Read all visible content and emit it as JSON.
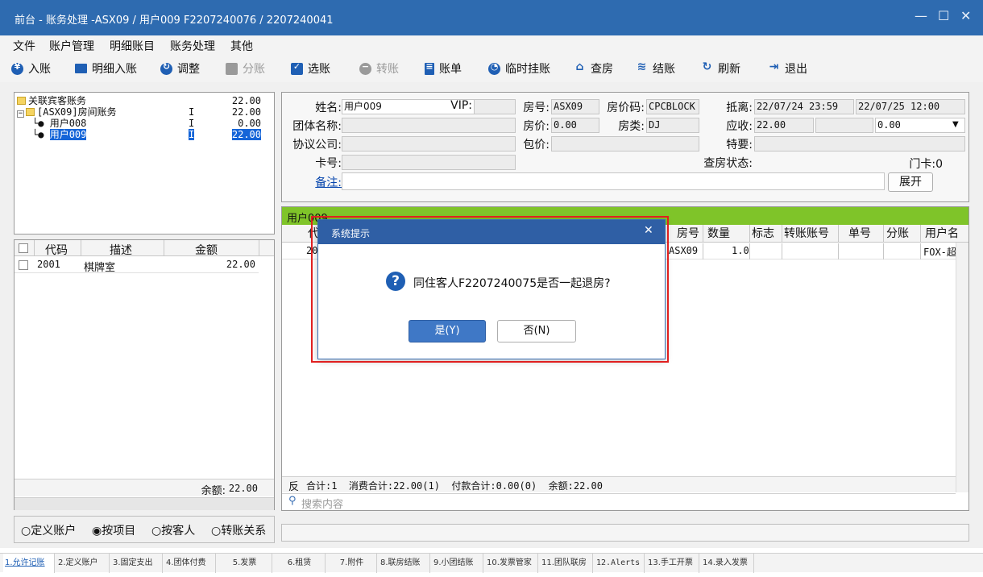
{
  "window": {
    "title": "前台 - 账务处理 -ASX09 / 用户009 F2207240076 / 2207240041",
    "minimize": "—",
    "maximize": "☐",
    "close": "✕"
  },
  "menu": [
    "文件",
    "账户管理",
    "明细账目",
    "账务处理",
    "其他"
  ],
  "toolbar": [
    {
      "label": "入账",
      "icon": "yen-coin-icon",
      "disabled": false
    },
    {
      "label": "明细入账",
      "icon": "monitor-icon",
      "disabled": false
    },
    {
      "label": "调整",
      "icon": "adjust-icon",
      "disabled": false
    },
    {
      "label": "分账",
      "icon": "split-icon",
      "disabled": true
    },
    {
      "label": "选账",
      "icon": "select-icon",
      "disabled": false
    },
    {
      "label": "转账",
      "icon": "transfer-icon",
      "disabled": true
    },
    {
      "label": "账单",
      "icon": "bill-icon",
      "disabled": false
    },
    {
      "label": "临时挂账",
      "icon": "clock-icon",
      "disabled": false
    },
    {
      "label": "查房",
      "icon": "house-icon",
      "disabled": false
    },
    {
      "label": "结账",
      "icon": "database-icon",
      "disabled": false
    },
    {
      "label": "刷新",
      "icon": "refresh-icon",
      "disabled": false
    },
    {
      "label": "退出",
      "icon": "exit-icon",
      "disabled": false
    }
  ],
  "tree": [
    {
      "label": "关联宾客账务",
      "flag": "",
      "amount": "22.00"
    },
    {
      "label": "[ASX09]房间账务",
      "flag": "I",
      "amount": "22.00"
    },
    {
      "label": "用户008",
      "flag": "I",
      "amount": "0.00"
    },
    {
      "label": "用户009",
      "flag": "I",
      "amount": "22.00"
    }
  ],
  "items_table": {
    "headers": [
      "代码",
      "描述",
      "金额"
    ],
    "rows": [
      {
        "code": "2001",
        "desc": "棋牌室",
        "amount": "22.00"
      }
    ],
    "balance_label": "余额:",
    "balance_value": "22.00"
  },
  "view_modes": [
    {
      "label": "定义账户",
      "checked": false
    },
    {
      "label": "按项目",
      "checked": true
    },
    {
      "label": "按客人",
      "checked": false
    },
    {
      "label": "转账关系",
      "checked": false
    }
  ],
  "guest": {
    "name_label": "姓名:",
    "name": "用户009",
    "vip_label": "VIP:",
    "vip": "",
    "room_label": "房号:",
    "room": "ASX09",
    "rate_code_label": "房价码:",
    "rate_code": "CPCBLOCK",
    "arrival_label": "抵离:",
    "arrival": "22/07/24 23:59",
    "departure": "22/07/25 12:00",
    "group_label": "团体名称:",
    "group": "",
    "price_label": "房价:",
    "price": "0.00",
    "room_type_label": "房类:",
    "room_type": "DJ",
    "receivable_label": "应收:",
    "receivable": "22.00",
    "receivable2": "0.00",
    "agreement_label": "协议公司:",
    "agreement": "",
    "package_label": "包价:",
    "package": "",
    "special_label": "特要:",
    "special": "",
    "card_label": "卡号:",
    "card": "",
    "inspect_label": "查房状态:",
    "inspect": "",
    "door_card": "门卡:0",
    "remark_label": "备注:",
    "remark": "",
    "expand_button": "展开"
  },
  "detail": {
    "header": "用户009",
    "columns": [
      "代",
      "房号",
      "数量",
      "标志",
      "转账账号",
      "单号",
      "分账",
      "用户名"
    ],
    "row": {
      "code": "20",
      "room": "ASX09",
      "qty": "1.0",
      "user": "FOX-超"
    },
    "summary_prefix": "反",
    "summary": "合计:1  消费合计:22.00(1)  付款合计:0.00(0)  余额:22.00",
    "search_placeholder": "搜索内容"
  },
  "dialog": {
    "title": "系统提示",
    "message": "同住客人F2207240075是否一起退房?",
    "yes": "是(Y)",
    "no": "否(N)",
    "close": "✕"
  },
  "status_tabs": [
    "1.允许记账",
    "2.定义账户",
    "3.固定支出",
    "4.团体付费",
    "5.发票",
    "6.租赁",
    "7.附件",
    "8.联房结账",
    "9.小团结账",
    "10.发票管家",
    "11.团队联房",
    "12.Alerts",
    "13.手工开票",
    "14.录入发票"
  ],
  "colors": {
    "title_bar": "#2e6bb0",
    "selection": "#1565d8",
    "detail_header": "#7fc429",
    "highlight_border": "#e02020",
    "link": "#0645ad"
  }
}
